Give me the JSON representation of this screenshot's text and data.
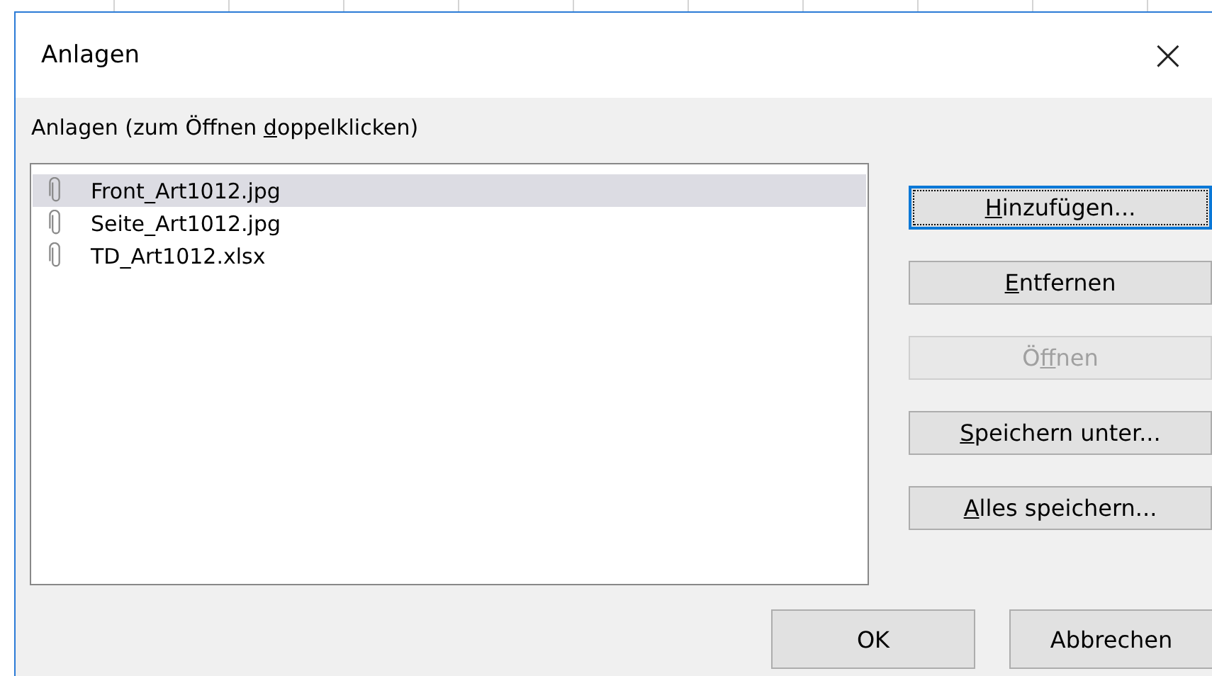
{
  "window": {
    "title": "Anlagen",
    "close": "×"
  },
  "list_label": [
    "Anlagen (zum Öffnen ",
    "d",
    "oppelklicken)"
  ],
  "attachments": [
    {
      "name": "Front_Art1012.jpg",
      "selected": true
    },
    {
      "name": "Seite_Art1012.jpg",
      "selected": false
    },
    {
      "name": "TD_Art1012.xlsx",
      "selected": false
    }
  ],
  "side_buttons": [
    {
      "label": {
        "key": "H",
        "after": "inzufügen..."
      },
      "disabled": false,
      "focused": true
    },
    {
      "label": {
        "key": "E",
        "after": "ntfernen"
      },
      "disabled": false,
      "focused": false
    },
    {
      "label": {
        "before": "Ö",
        "key": "f",
        "after": "fnen"
      },
      "disabled": true,
      "focused": false
    },
    {
      "label": {
        "key": "S",
        "after": "peichern unter..."
      },
      "disabled": false,
      "focused": false
    },
    {
      "label": {
        "key": "A",
        "after": "lles speichern..."
      },
      "disabled": false,
      "focused": false
    }
  ],
  "footer_buttons": [
    {
      "label": "OK"
    },
    {
      "label": "Abbrechen"
    }
  ]
}
